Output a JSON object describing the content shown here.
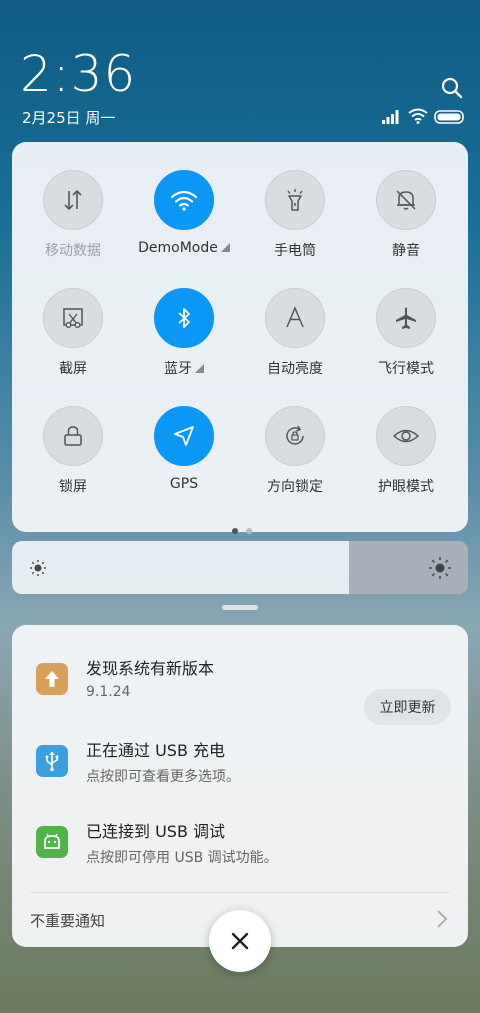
{
  "status": {
    "time": "2:36",
    "date": "2月25日 周一"
  },
  "quick_settings": {
    "tiles": [
      {
        "label": "移动数据",
        "icon": "mobile-data-icon",
        "active": false
      },
      {
        "label": "DemoMode",
        "icon": "wifi-icon",
        "active": true
      },
      {
        "label": "手电筒",
        "icon": "flashlight-icon",
        "active": false
      },
      {
        "label": "静音",
        "icon": "mute-bell-icon",
        "active": false
      },
      {
        "label": "截屏",
        "icon": "screenshot-icon",
        "active": false
      },
      {
        "label": "蓝牙",
        "icon": "bluetooth-icon",
        "active": true
      },
      {
        "label": "自动亮度",
        "icon": "auto-brightness-icon",
        "active": false
      },
      {
        "label": "飞行模式",
        "icon": "airplane-icon",
        "active": false
      },
      {
        "label": "锁屏",
        "icon": "lock-icon",
        "active": false
      },
      {
        "label": "GPS",
        "icon": "gps-icon",
        "active": true
      },
      {
        "label": "方向锁定",
        "icon": "rotation-lock-icon",
        "active": false
      },
      {
        "label": "护眼模式",
        "icon": "eye-icon",
        "active": false
      }
    ],
    "page_index": 1,
    "page_count": 2
  },
  "brightness": {
    "level": 0.74
  },
  "notifications": [
    {
      "title": "发现系统有新版本",
      "subtitle": "9.1.24",
      "action": "立即更新",
      "icon": "update-arrow-icon",
      "color": "#d9a05a"
    },
    {
      "title": "正在通过 USB 充电",
      "subtitle": "点按即可查看更多选项。",
      "icon": "usb-icon",
      "color": "#3aa0e0"
    },
    {
      "title": "已连接到 USB 调试",
      "subtitle": "点按即可停用 USB 调试功能。",
      "icon": "android-icon",
      "color": "#4fb548"
    }
  ],
  "unimportant_label": "不重要通知",
  "colors": {
    "accent": "#0a97f5"
  }
}
